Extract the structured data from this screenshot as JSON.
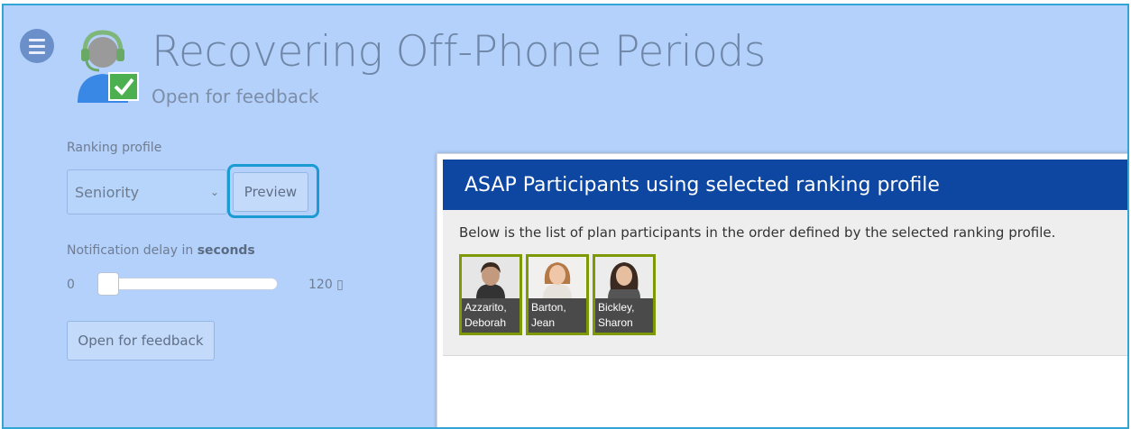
{
  "header": {
    "title": "Recovering Off-Phone Periods",
    "status": "Open for feedback"
  },
  "icons": {
    "menu": "hamburger-menu-icon",
    "logo": "agent-headset-checkmark-icon"
  },
  "form": {
    "ranking_label": "Ranking profile",
    "ranking_value": "Seniority",
    "preview_label": "Preview",
    "delay_label_prefix": "Notification delay in ",
    "delay_label_bold": "seconds",
    "slider": {
      "min": "0",
      "max_text": "120 ▯",
      "value": 0
    },
    "feedback_button": "Open for feedback"
  },
  "dialog": {
    "title": "ASAP Participants using selected ranking profile",
    "description": "Below is the list of plan participants in the order defined by the selected ranking profile.",
    "participants": [
      {
        "last": "Azzarito,",
        "first": "Deborah"
      },
      {
        "last": "Barton,",
        "first": "Jean"
      },
      {
        "last": "Bickley,",
        "first": "Sharon"
      }
    ]
  },
  "colors": {
    "background": "#b3d1fb",
    "dialog_header": "#0d47a1",
    "card_border": "#7d9a06",
    "highlight": "#1a9bd3"
  }
}
